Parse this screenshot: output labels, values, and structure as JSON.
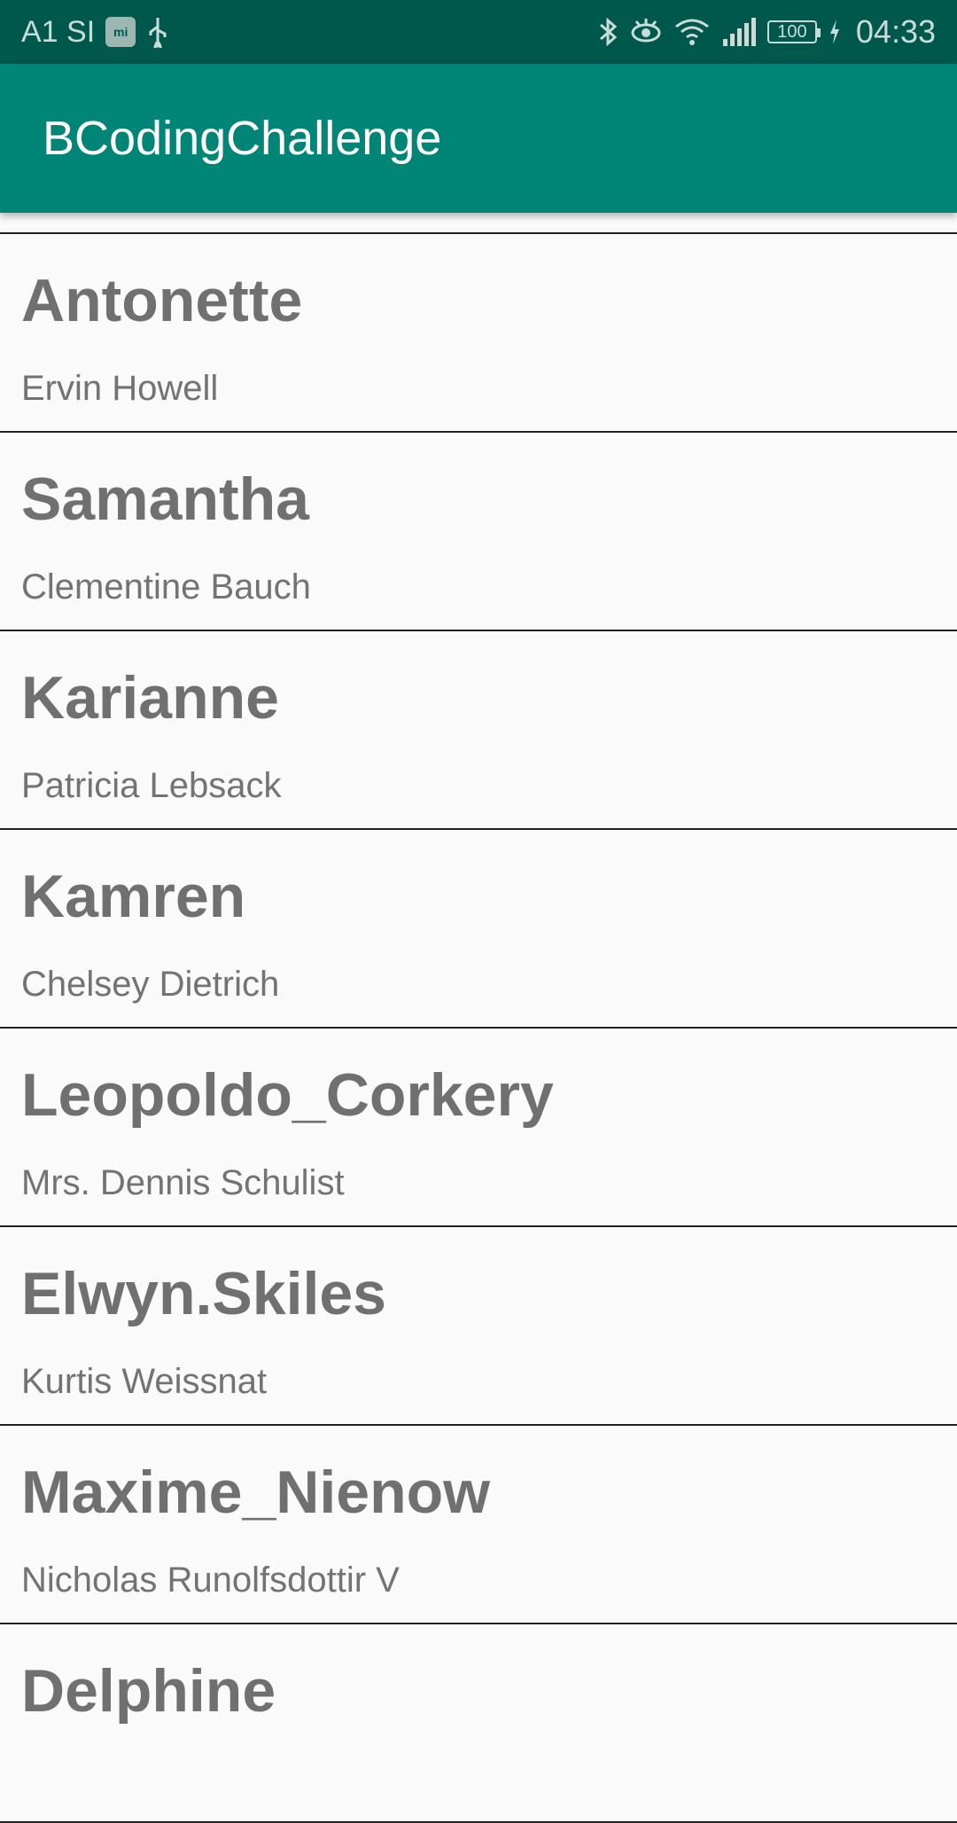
{
  "status_bar": {
    "carrier": "A1 SI",
    "mi_label": "mi",
    "battery": "100",
    "time": "04:33"
  },
  "app_bar": {
    "title": "BCodingChallenge"
  },
  "users": [
    {
      "username": "Antonette",
      "name": "Ervin Howell"
    },
    {
      "username": "Samantha",
      "name": "Clementine Bauch"
    },
    {
      "username": "Karianne",
      "name": "Patricia Lebsack"
    },
    {
      "username": "Kamren",
      "name": "Chelsey Dietrich"
    },
    {
      "username": "Leopoldo_Corkery",
      "name": "Mrs. Dennis Schulist"
    },
    {
      "username": "Elwyn.Skiles",
      "name": "Kurtis Weissnat"
    },
    {
      "username": "Maxime_Nienow",
      "name": "Nicholas Runolfsdottir V"
    },
    {
      "username": "Delphine",
      "name": ""
    }
  ],
  "colors": {
    "status_bar": "#00574b",
    "app_bar": "#008577",
    "background": "#fafafa",
    "text": "#707070"
  }
}
